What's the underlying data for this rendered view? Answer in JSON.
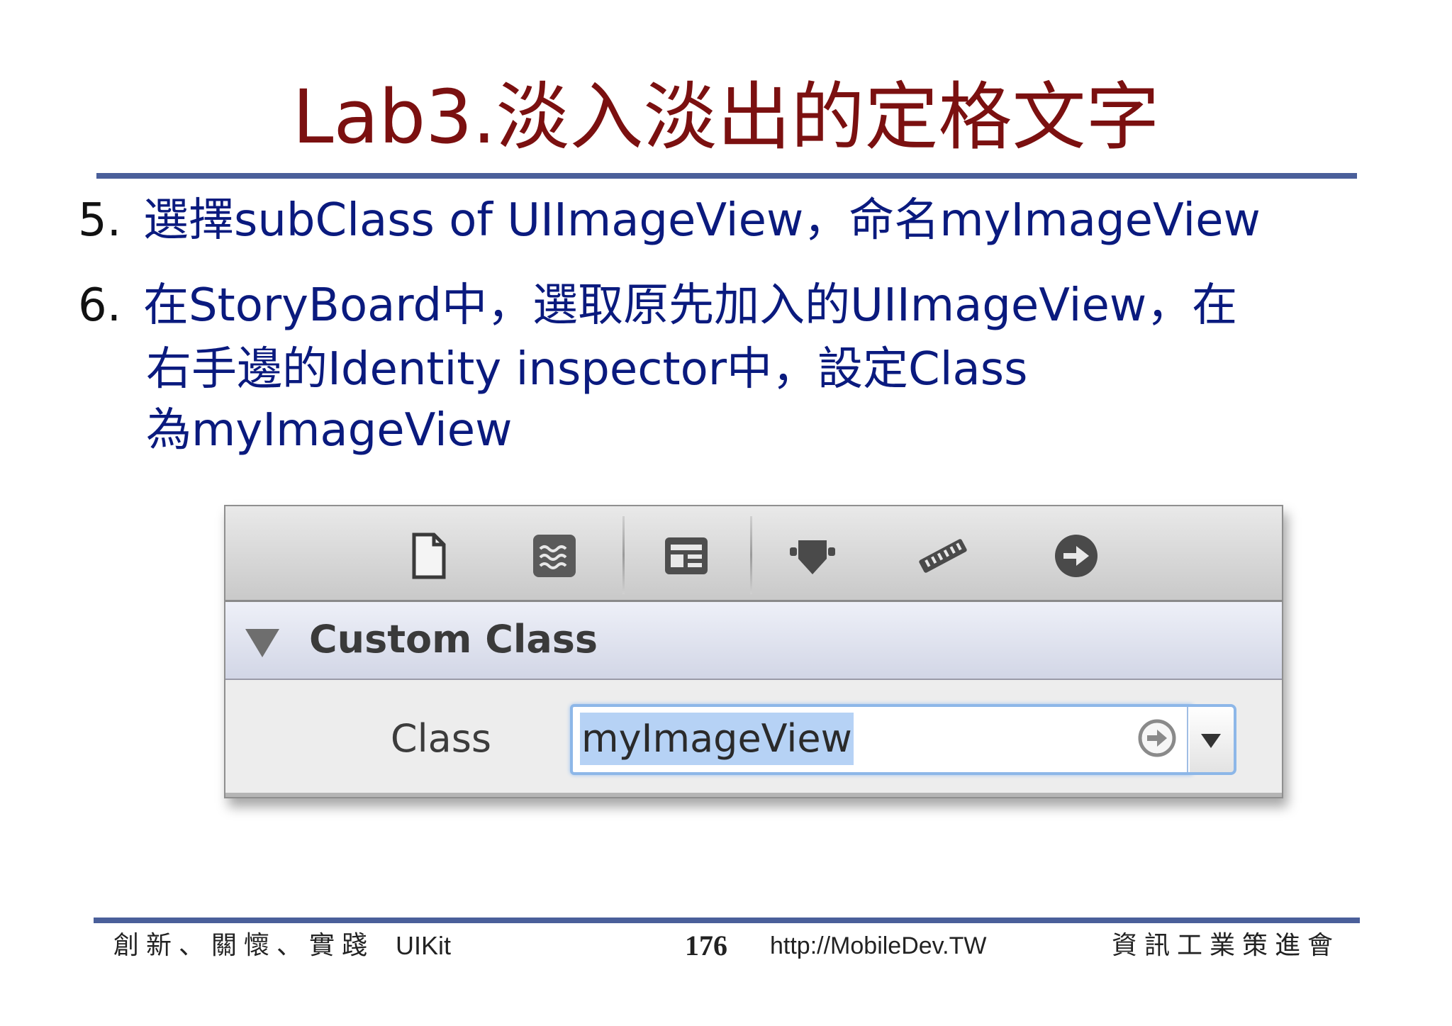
{
  "slide": {
    "title": "Lab3.淡入淡出的定格文字"
  },
  "steps": [
    {
      "number": "5.",
      "text": "選擇subClass of UIImageView，命名myImageView"
    },
    {
      "number": "6.",
      "lines": [
        "在StoryBoard中，選取原先加入的UIImageView，在",
        "右手邊的Identity inspector中，設定Class",
        "為myImageView"
      ]
    }
  ],
  "inspector": {
    "toolbar_icons": [
      "file-inspector-icon",
      "quick-help-icon",
      "identity-inspector-icon",
      "attributes-inspector-icon",
      "size-inspector-icon",
      "connections-inspector-icon"
    ],
    "section_title": "Custom Class",
    "class_label": "Class",
    "class_value": "myImageView"
  },
  "footer": {
    "motto": "創新、關懷、實踐",
    "course": "UIKit",
    "page_number": "176",
    "url": "http://MobileDev.TW",
    "organization": "資訊工業策進會"
  },
  "colors": {
    "title": "#7b1010",
    "body_text": "#0a1a7e",
    "rule": "#4a5f9a",
    "selection": "#b6d2f5"
  }
}
